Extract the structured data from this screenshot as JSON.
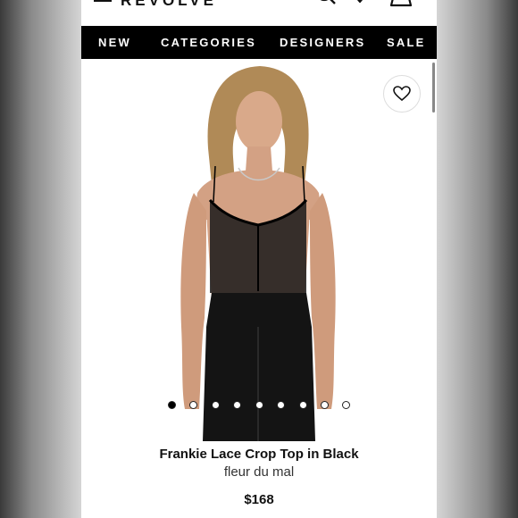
{
  "header": {
    "logo": "REVOLVE",
    "icons": [
      "menu-icon",
      "search-icon",
      "heart-icon",
      "bag-icon"
    ]
  },
  "nav": {
    "items": [
      {
        "label": "NEW"
      },
      {
        "label": "CATEGORIES"
      },
      {
        "label": "DESIGNERS"
      },
      {
        "label": "SALE"
      }
    ]
  },
  "product": {
    "title": "Frankie Lace Crop Top in Black",
    "brand": "fleur du mal",
    "price": "$168",
    "image_count": 9,
    "active_image": 1
  },
  "colors": {
    "nav_bg": "#000000",
    "nav_text": "#ffffff",
    "text": "#111111"
  }
}
